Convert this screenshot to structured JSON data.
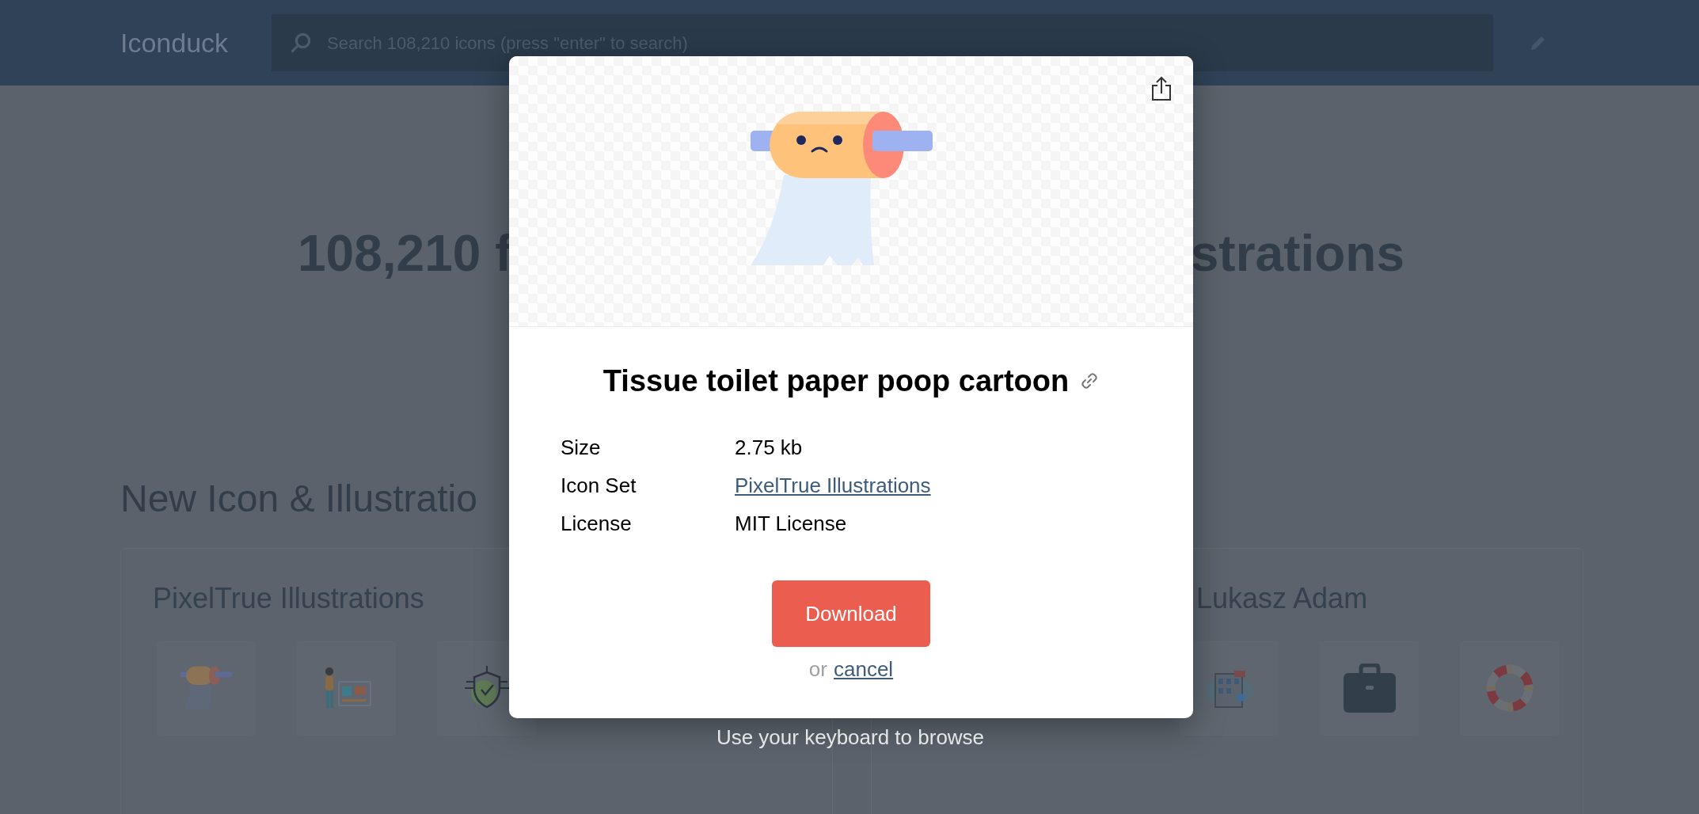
{
  "header": {
    "logo": "Iconduck",
    "search": {
      "placeholder": "Search 108,210 icons (press \"enter\" to search)"
    }
  },
  "hero": {
    "title_left": "108,210 f",
    "title_right": "strations"
  },
  "section_title": "New Icon & Illustratio",
  "sets": [
    {
      "title": "PixelTrue Illustrations",
      "icons": [
        {
          "kind": "toilet-paper"
        },
        {
          "kind": "person-screen"
        },
        {
          "kind": "shield"
        }
      ]
    },
    {
      "title": "Lukasz Adam",
      "icons": [
        {
          "kind": "building"
        },
        {
          "kind": "briefcase"
        },
        {
          "kind": "lifebuoy"
        }
      ]
    }
  ],
  "modal": {
    "title": "Tissue toilet paper poop cartoon",
    "details": [
      {
        "label": "Size",
        "value": "2.75 kb",
        "kind": "text"
      },
      {
        "label": "Icon Set",
        "value": "PixelTrue Illustrations",
        "kind": "link"
      },
      {
        "label": "License",
        "value": "MIT License",
        "kind": "text"
      }
    ],
    "download_button": "Download",
    "cancel_prefix": "or",
    "cancel_link": "cancel"
  },
  "hint": "Use your keyboard to browse"
}
